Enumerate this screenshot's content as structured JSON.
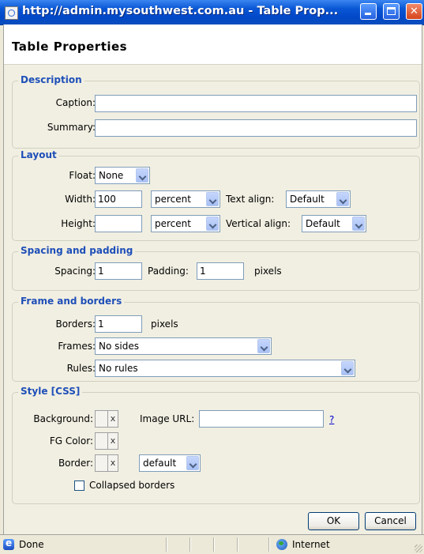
{
  "window": {
    "title": "http://admin.mysouthwest.com.au - Table Prop..."
  },
  "dialog": {
    "title": "Table Properties"
  },
  "description": {
    "legend": "Description",
    "caption_label": "Caption:",
    "caption_value": "",
    "summary_label": "Summary:",
    "summary_value": ""
  },
  "layout": {
    "legend": "Layout",
    "float_label": "Float:",
    "float_value": "None",
    "width_label": "Width:",
    "width_value": "100",
    "width_unit": "percent",
    "text_align_label": "Text align:",
    "text_align_value": "Default",
    "height_label": "Height:",
    "height_value": "",
    "height_unit": "percent",
    "vertical_align_label": "Vertical align:",
    "vertical_align_value": "Default"
  },
  "spacing": {
    "legend": "Spacing and padding",
    "spacing_label": "Spacing:",
    "spacing_value": "1",
    "padding_label": "Padding:",
    "padding_value": "1",
    "unit": "pixels"
  },
  "frame": {
    "legend": "Frame and borders",
    "borders_label": "Borders:",
    "borders_value": "1",
    "borders_unit": "pixels",
    "frames_label": "Frames:",
    "frames_value": "No sides",
    "rules_label": "Rules:",
    "rules_value": "No rules"
  },
  "style": {
    "legend": "Style [CSS]",
    "background_label": "Background:",
    "image_url_label": "Image URL:",
    "image_url_value": "",
    "help_link": "?",
    "fg_color_label": "FG Color:",
    "border_label": "Border:",
    "border_style_value": "default",
    "collapsed_label": "Collapsed borders",
    "collapsed_checked": false,
    "clear_glyph": "x"
  },
  "buttons": {
    "ok": "OK",
    "cancel": "Cancel"
  },
  "statusbar": {
    "status": "Done",
    "zone": "Internet"
  },
  "colors": {
    "accent": "#1e4fb8",
    "titlebar": "#0148c8",
    "panel": "#f1efe2"
  }
}
